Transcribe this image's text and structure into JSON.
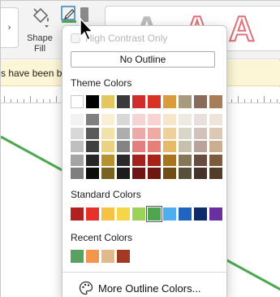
{
  "ribbon": {
    "scroll_left_glyph": "›",
    "shape_fill_label": "Shape Fill",
    "outline_icon": "pen-outline-icon",
    "text_style_glyph": "A"
  },
  "infobar": {
    "text": "s have been b"
  },
  "menu": {
    "high_contrast_label": "High Contrast Only",
    "no_outline_label": "No Outline",
    "theme_colors_label": "Theme Colors",
    "theme_top_row": [
      "#ffffff",
      "#000000",
      "#e4c75c",
      "#3a3a3a",
      "#cf2f2c",
      "#d83227",
      "#d89c3c",
      "#a89a7f",
      "#8a6a5c",
      "#a87e58"
    ],
    "theme_shades": [
      [
        "#f2f2f2",
        "#7f7f7f",
        "#f9f0d4",
        "#d8d8d8",
        "#f5d5d4",
        "#f7d4d1",
        "#f6e6cc",
        "#eceae3",
        "#e8e0dc",
        "#eee4d9"
      ],
      [
        "#d8d8d8",
        "#595959",
        "#f3e1aa",
        "#adadad",
        "#ebaaa8",
        "#efaaa4",
        "#eed09b",
        "#dad5c9",
        "#d1c2bb",
        "#dcc9b4"
      ],
      [
        "#bfbfbf",
        "#3f3f3f",
        "#ecd180",
        "#838383",
        "#e2807d",
        "#e67f77",
        "#e5bb6a",
        "#c7c0ae",
        "#b9a39a",
        "#cbad8f"
      ],
      [
        "#a5a5a5",
        "#262626",
        "#b79330",
        "#2a2a2a",
        "#a3211f",
        "#a82119",
        "#a8741f",
        "#847659",
        "#674c40",
        "#7d5c3c"
      ],
      [
        "#7f7f7f",
        "#0c0c0c",
        "#7a6220",
        "#1c1c1c",
        "#6d1614",
        "#701611",
        "#704d15",
        "#584f3b",
        "#45332b",
        "#533d28"
      ]
    ],
    "standard_colors_label": "Standard Colors",
    "standard_colors": [
      "#b2201f",
      "#e8302a",
      "#f5c244",
      "#f5d649",
      "#9bd35a",
      "#4ca54f",
      "#4eaef0",
      "#2064c0",
      "#0d2a6b",
      "#6a2fa0"
    ],
    "selected_standard_index": 5,
    "recent_colors_label": "Recent Colors",
    "recent_colors": [
      "#59a062",
      "#f3954d",
      "#e0b98c",
      "#a43922"
    ],
    "more_colors_label": "More Outline Colors...",
    "more_colors_icon": "palette-icon"
  },
  "canvas": {
    "line_color": "#4ea852"
  }
}
